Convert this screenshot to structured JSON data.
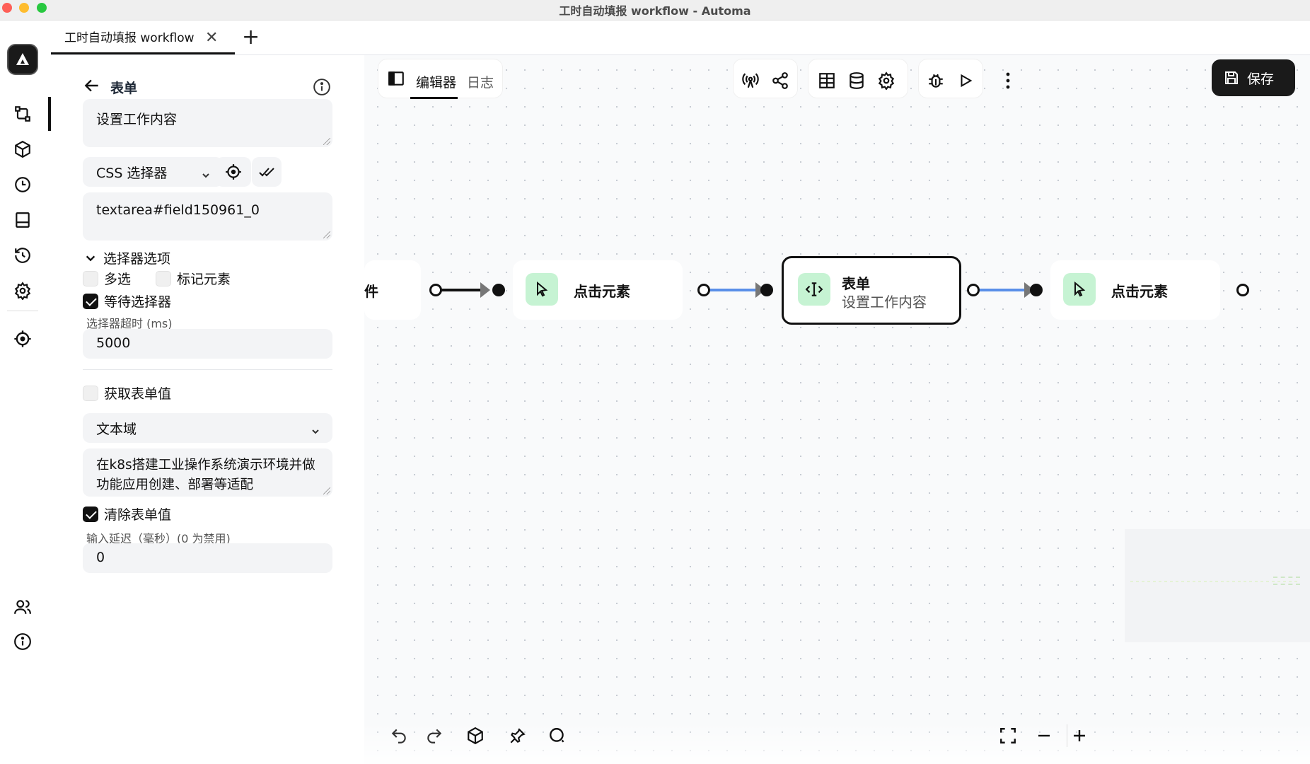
{
  "window": {
    "title": "工时自动填报 workflow - Automa"
  },
  "tabs": [
    {
      "title": "工时自动填报 workflow",
      "close": "✕"
    }
  ],
  "tab_add": "+",
  "rail": {
    "icons": [
      "automa-logo-icon",
      "workflow-icon",
      "package-icon",
      "clock-icon",
      "storage-icon",
      "history-icon",
      "settings-icon",
      "crosshair-icon",
      "users-icon",
      "info-icon"
    ]
  },
  "panel": {
    "title": "表单",
    "description": "设置工作内容",
    "selector_type": "CSS 选择器",
    "selector_value": "textarea#field150961_0",
    "selector_options_label": "选择器选项",
    "multiple_label": "多选",
    "mark_element_label": "标记元素",
    "wait_selector_label": "等待选择器",
    "wait_selector_checked": true,
    "timeout_label": "选择器超时 (ms)",
    "timeout_value": "5000",
    "get_value_label": "获取表单值",
    "get_value_checked": false,
    "form_type": "文本域",
    "form_text": "在k8s搭建工业操作系统演示环境并做功能应用创建、部署等适配",
    "clear_value_label": "清除表单值",
    "clear_value_checked": true,
    "delay_label": "输入延迟（毫秒）(0 为禁用)",
    "delay_value": "0"
  },
  "editor": {
    "tab_editor": "编辑器",
    "tab_log": "日志",
    "save_label": "保存"
  },
  "nodes": [
    {
      "label": "件"
    },
    {
      "label": "点击元素"
    },
    {
      "label": "表单",
      "sub": "设置工作内容"
    },
    {
      "label": "点击元素"
    }
  ],
  "colors": {
    "node_icon_bg": "#c6f3d3",
    "edge_blue": "#5a8fe8",
    "accent_dark": "#1a1a1a"
  }
}
